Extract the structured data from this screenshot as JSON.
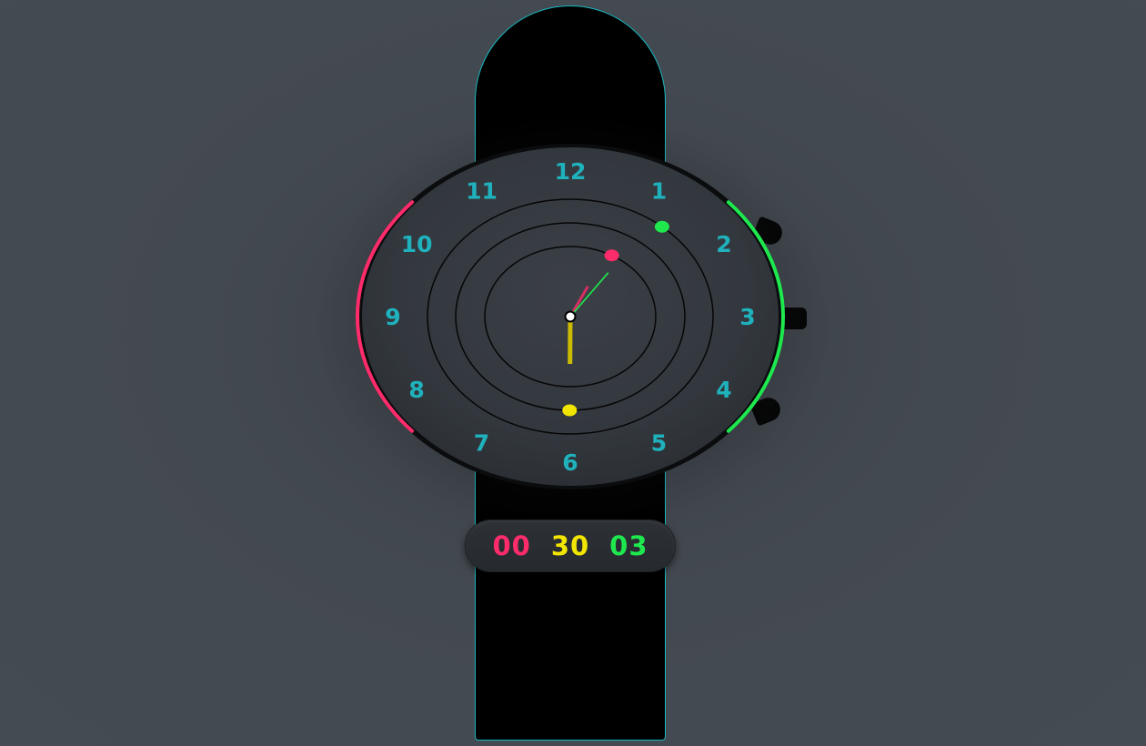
{
  "colors": {
    "background": "#444a52",
    "strap": "#000000",
    "strap_outline": "#16b8c0",
    "dial": "#33383e",
    "numerals": "#1fb2bd",
    "hours_accent": "#ff2c6c",
    "minutes_accent": "#f2e600",
    "seconds_accent": "#1ee84e"
  },
  "dial": {
    "numerals": [
      "12",
      "1",
      "2",
      "3",
      "4",
      "5",
      "6",
      "7",
      "8",
      "9",
      "10",
      "11"
    ]
  },
  "time": {
    "hours": 0,
    "minutes": 30,
    "seconds": 3
  },
  "readout": {
    "hours": "00",
    "minutes": "30",
    "seconds": "03"
  }
}
